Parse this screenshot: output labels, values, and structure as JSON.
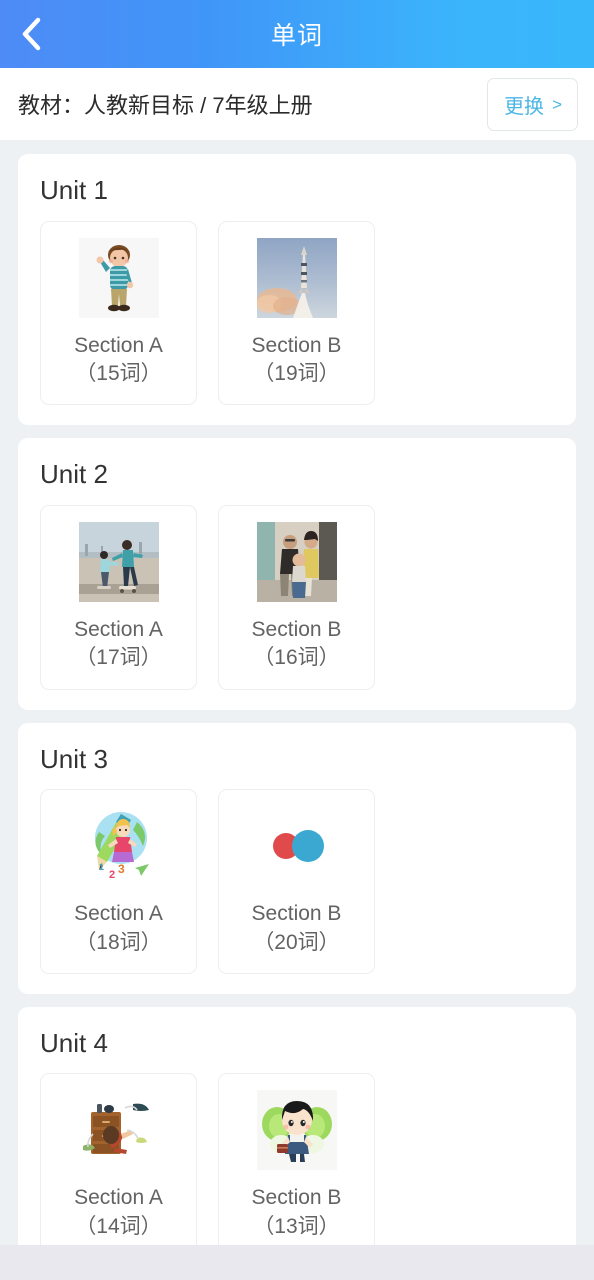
{
  "header": {
    "title": "单词",
    "back_icon": "chevron-left-icon",
    "gradient_start": "#4e8bf6",
    "gradient_end": "#38b8fb"
  },
  "textbook_bar": {
    "label": "教材：人教新目标 / 7年级上册",
    "change_label": "更换",
    "change_chevron": ">",
    "accent_color": "#4cb6e6"
  },
  "units": [
    {
      "title": "Unit 1",
      "sections": [
        {
          "name": "Section A",
          "count": "（15词）",
          "thumb": "boy-waving-image"
        },
        {
          "name": "Section B",
          "count": "（19词）",
          "thumb": "rocket-launch-image"
        }
      ]
    },
    {
      "title": "Unit 2",
      "sections": [
        {
          "name": "Section A",
          "count": "（17词）",
          "thumb": "kids-skateboarding-image"
        },
        {
          "name": "Section B",
          "count": "（16词）",
          "thumb": "family-photo-image"
        }
      ]
    },
    {
      "title": "Unit 3",
      "sections": [
        {
          "name": "Section A",
          "count": "（18词）",
          "thumb": "girl-with-pencil-illustration"
        },
        {
          "name": "Section B",
          "count": "（20词）",
          "thumb": "two-circles-icon"
        }
      ]
    },
    {
      "title": "Unit 4",
      "sections": [
        {
          "name": "Section A",
          "count": "（14词）",
          "thumb": "dresser-search-illustration"
        },
        {
          "name": "Section B",
          "count": "（13词）",
          "thumb": "chibi-cabbage-illustration"
        }
      ]
    }
  ]
}
